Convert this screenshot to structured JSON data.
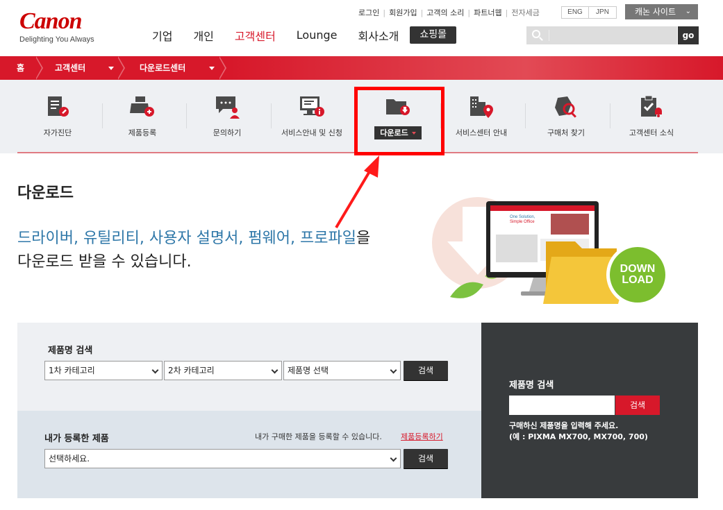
{
  "brand": {
    "name": "Canon",
    "tagline": "Delighting You Always",
    "accent_color": "#d7182a"
  },
  "header": {
    "util_links": [
      "로그인",
      "회원가입",
      "고객의 소리",
      "파트너웹",
      "전자세금"
    ],
    "lang": [
      "ENG",
      "JPN"
    ],
    "site_button": "캐논 사이트",
    "nav": [
      "기업",
      "개인",
      "고객센터",
      "Lounge",
      "회사소개"
    ],
    "nav_active": "고객센터",
    "mall_button": "쇼핑몰",
    "search": {
      "placeholder": "",
      "go_label": "go"
    }
  },
  "breadcrumb": {
    "home": "홈",
    "level1": "고객센터",
    "level2": "다운로드센터"
  },
  "quick_menu": [
    {
      "label": "자가진단",
      "icon": "document-wrench-icon"
    },
    {
      "label": "제품등록",
      "icon": "printer-plus-icon"
    },
    {
      "label": "문의하기",
      "icon": "chat-person-icon"
    },
    {
      "label": "서비스안내 및 신청",
      "icon": "monitor-info-icon"
    },
    {
      "label": "다운로드",
      "icon": "folder-download-icon",
      "active": true
    },
    {
      "label": "서비스센터 안내",
      "icon": "building-pin-icon"
    },
    {
      "label": "구매처 찾기",
      "icon": "search-location-icon"
    },
    {
      "label": "고객센터 소식",
      "icon": "clipboard-bell-icon"
    }
  ],
  "main": {
    "title": "다운로드",
    "intro_highlight": "드라이버, 유틸리티, 사용자 설명서, 펌웨어, 프로파일",
    "intro_suffix": "을",
    "intro_line2": "다운로드 받을 수 있습니다.",
    "hero": {
      "folder_badge_line1": "DOWN",
      "folder_badge_line2": "LOAD",
      "screen_text_line1": "One Solution,",
      "screen_text_line2": "Simple Office"
    }
  },
  "product_search": {
    "title": "제품명 검색",
    "select1": "1차 카테고리",
    "select2": "2차 카테고리",
    "select3": "제품명 선택",
    "button": "검색"
  },
  "my_products": {
    "title": "내가 등록한 제품",
    "hint": "내가 구매한 제품을 등록할 수 있습니다.",
    "link": "제품등록하기",
    "select": "선택하세요.",
    "button": "검색"
  },
  "name_search": {
    "title": "제품명 검색",
    "input_value": "",
    "button": "검색",
    "hint_line1": "구매하신 제품명을 입력해 주세요.",
    "hint_line2": "(예 : PIXMA MX700, MX700, 700)"
  }
}
